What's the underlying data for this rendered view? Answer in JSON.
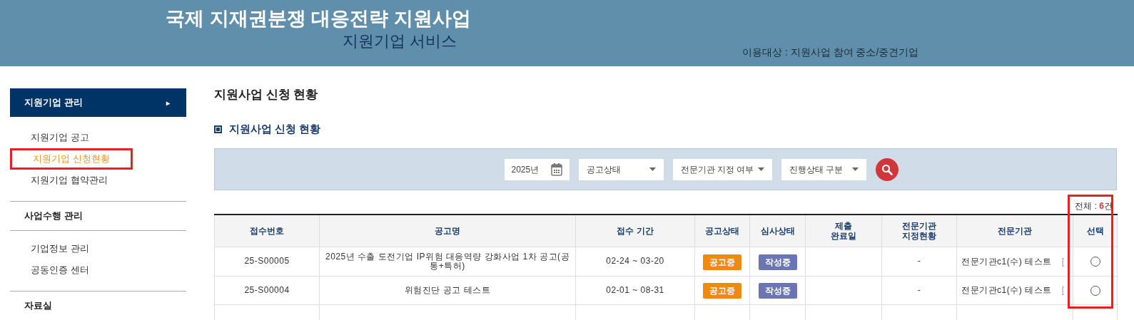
{
  "header": {
    "title": "국제 지재권분쟁 대응전략 지원사업",
    "subtitle": "지원기업 서비스",
    "audience": "이용대상 : 지원사업 참여 중소/중견기업"
  },
  "sidebar": {
    "sections": [
      {
        "label": "지원기업 관리",
        "expanded": true,
        "arrow": "▸",
        "items": [
          {
            "label": "지원기업 공고",
            "selected": false,
            "highlighted": false
          },
          {
            "label": "지원기업 신청현황",
            "selected": true,
            "highlighted": true
          },
          {
            "label": "지원기업 협약관리",
            "selected": false,
            "highlighted": false
          }
        ]
      },
      {
        "label": "사업수행 관리",
        "expanded": false,
        "items": [
          {
            "label": "기업정보 관리",
            "selected": false,
            "highlighted": false
          },
          {
            "label": "공동인증 센터",
            "selected": false,
            "highlighted": false
          }
        ]
      },
      {
        "label": "자료실",
        "expanded": false
      }
    ]
  },
  "page_title": "지원사업 신청 현황",
  "section_title": "지원사업 신청 현황",
  "filters": [
    {
      "kind": "date",
      "value": "2025년"
    },
    {
      "kind": "select",
      "value": "공고상태"
    },
    {
      "kind": "select-compact",
      "value": "전문기관 지정 여부"
    },
    {
      "kind": "select",
      "value": "진행상태 구분"
    }
  ],
  "total": {
    "label": "전체 : ",
    "count": "6",
    "unit": "건"
  },
  "table": {
    "highlight_last_column": true,
    "columns": [
      "접수번호",
      "공고명",
      "접수 기간",
      "공고상태",
      "심사상태",
      "제출\n완료일",
      "전문기관\n지정현황",
      "전문기관",
      "선택"
    ],
    "rows": [
      {
        "number": "25-S00005",
        "title": "2025년 수출 도전기업 IP위험 대응역량 강화사업 1차 공고(공통+특허)",
        "period": "02-24 ~ 03-20",
        "notice_status": "공고중",
        "review_status": "작성중",
        "agency_status": "-",
        "agency": "전문기관c1(수) 테스트",
        "agency_mark": "[",
        "selected": false
      },
      {
        "number": "25-S00004",
        "title": "위험진단 공고 테스트",
        "period": "02-01 ~ 08-31",
        "notice_status": "공고중",
        "review_status": "작성중",
        "agency_status": "-",
        "agency": "전문기관c1(수) 테스트",
        "agency_mark": "[",
        "selected": false
      }
    ]
  }
}
